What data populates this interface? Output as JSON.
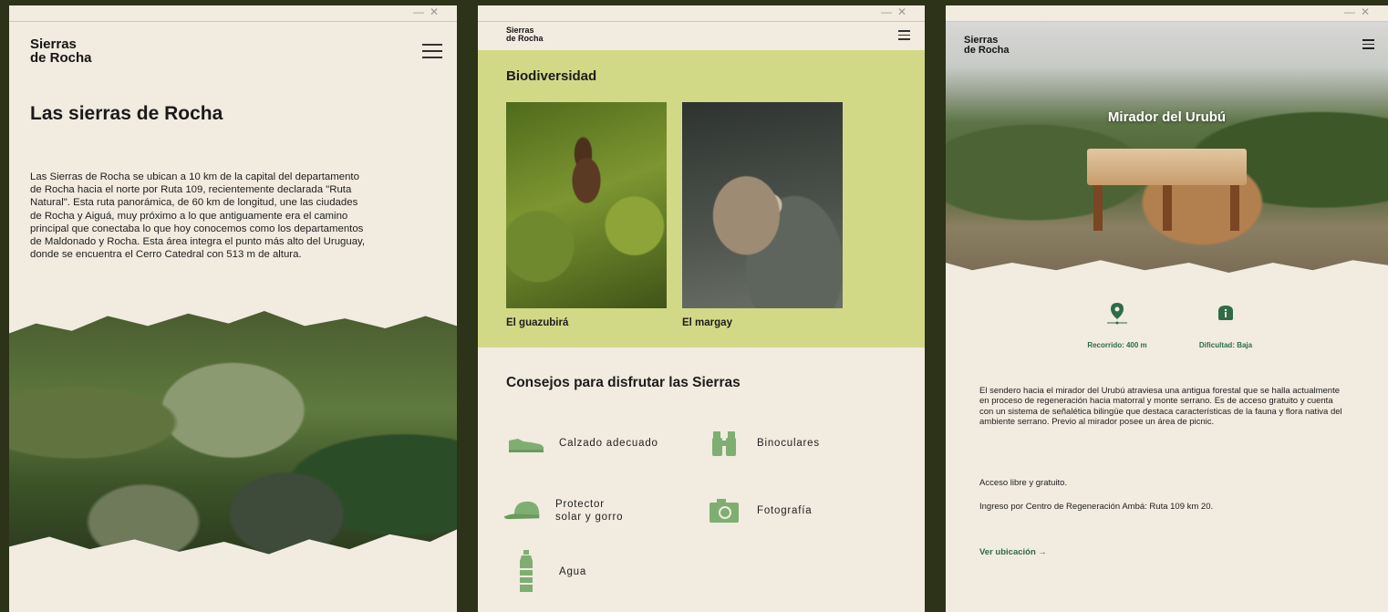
{
  "colors": {
    "outer_bg": "#2c3318",
    "panel_bg": "#f1ebe0",
    "biodiversity_bg": "#d2d986",
    "accent_green": "#2f6b47",
    "icon_green": "#7fae72"
  },
  "window_controls": {
    "minimize": "—",
    "close": "✕"
  },
  "brand": {
    "line1": "Sierras",
    "line2": "de Rocha"
  },
  "panel1": {
    "title": "Las sierras de Rocha",
    "body": "Las Sierras de Rocha se ubican a 10 km de la capital del departamento de Rocha hacia el norte por Ruta 109, recientemente declarada \"Ruta Natural\". Esta ruta panorámica, de 60 km de longitud, une las ciudades de Rocha y Aiguá, muy próximo a lo que antiguamente era el camino principal que conectaba lo que hoy conocemos como los departamentos de Maldonado y Rocha. Esta área integra el punto más alto del Uruguay, donde se encuentra el Cerro Catedral con 513 m de altura."
  },
  "panel2": {
    "bio_title": "Biodiversidad",
    "animals": [
      {
        "label": "El guazubirá"
      },
      {
        "label": "El margay"
      }
    ],
    "tips_title": "Consejos para disfrutar las Sierras",
    "tips": [
      {
        "label": "Calzado adecuado",
        "icon": "shoe-icon"
      },
      {
        "label": "Binoculares",
        "icon": "binoculars-icon"
      },
      {
        "label": "Protector\nsolar y gorro",
        "icon": "cap-icon"
      },
      {
        "label": "Fotografía",
        "icon": "camera-icon"
      },
      {
        "label": "Agua",
        "icon": "water-bottle-icon"
      }
    ]
  },
  "panel3": {
    "hero_title": "Mirador del Urubú",
    "meta": [
      {
        "label": "Recorrido: 400 m",
        "icon": "location-pin-icon"
      },
      {
        "label": "Dificultad: Baja",
        "icon": "info-icon"
      }
    ],
    "description": "El sendero hacia el mirador del Urubú atraviesa una antigua forestal que se halla actualmente en proceso de regeneración hacia matorral y monte serrano. Es de acceso gratuito y cuenta con un sistema de señalética bilingüe que destaca características de la fauna y flora nativa del ambiente serrano. Previo al mirador posee un área de picnic.",
    "access": "Acceso libre y gratuito.",
    "entry": "Ingreso por Centro de Regeneración Ambá: Ruta 109 km 20.",
    "location_link": "Ver ubicación →"
  }
}
